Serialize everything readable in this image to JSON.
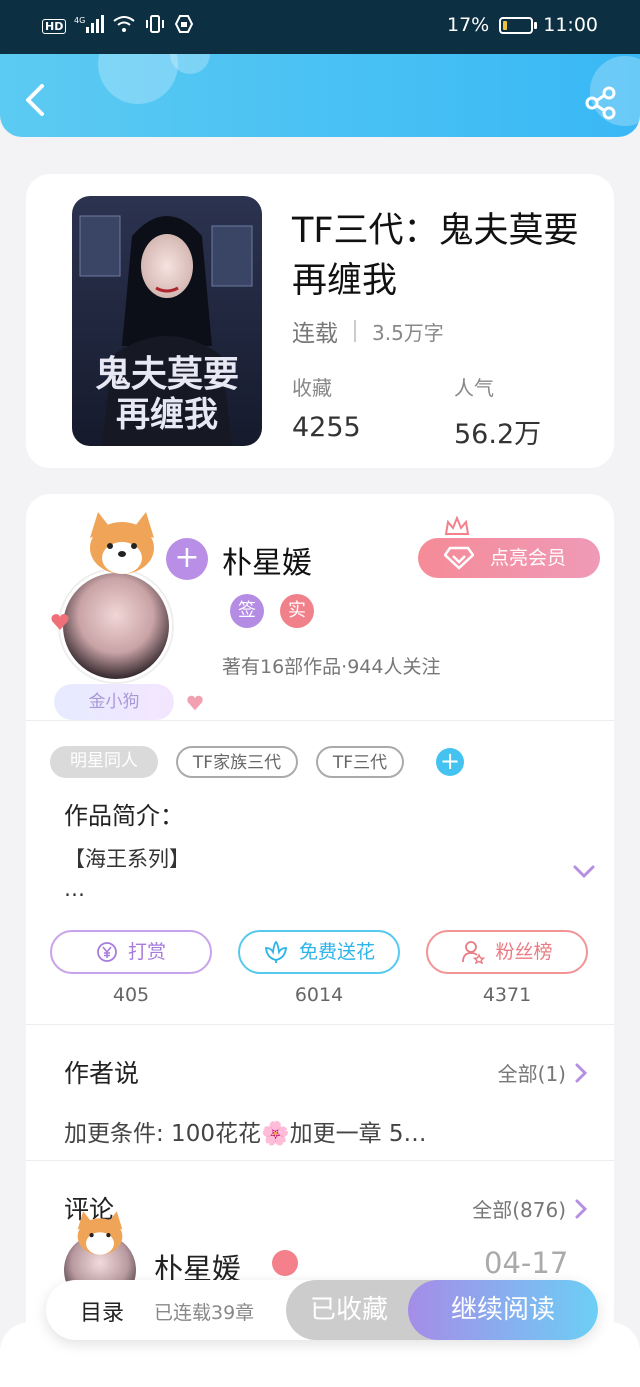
{
  "status_bar": {
    "network_icons": [
      "hd-icon",
      "signal-4g-icon",
      "wifi-icon",
      "vibrate-icon",
      "vpn-icon"
    ],
    "hd": "HD",
    "network": "4G",
    "battery": "17%",
    "battery_level": 0.17,
    "time": "11:00"
  },
  "header": {
    "back_icon": "chevron-left-icon",
    "share_icon": "share-icon"
  },
  "book": {
    "title": "TF三代：鬼夫莫要再缠我",
    "status": "连载",
    "word_count": "3.5万字",
    "favorites_label": "收藏",
    "favorites_value": "4255",
    "popularity_label": "人气",
    "popularity_value": "56.2万",
    "cover_text_line1": "鬼夫莫要",
    "cover_text_line2": "再缠我"
  },
  "author": {
    "name": "朴星媛",
    "fan_badge": "金小狗",
    "vip_button": "点亮会员",
    "badges": [
      {
        "label": "签",
        "color": "#b48ce3"
      },
      {
        "label": "实",
        "color": "#f0808a"
      }
    ],
    "meta": "著有16部作品·944人关注",
    "follow_symbol": "+"
  },
  "tags": [
    {
      "label": "明星同人",
      "style": "filled"
    },
    {
      "label": "TF家族三代",
      "style": "outline"
    },
    {
      "label": "TF三代",
      "style": "outline"
    }
  ],
  "tag_add_symbol": "+",
  "intro": {
    "title": "作品简介：",
    "text": "【海王系列】",
    "ellipsis": "…"
  },
  "actions": [
    {
      "label": "打赏",
      "count": "405",
      "icon": "yen-coin-icon"
    },
    {
      "label": "免费送花",
      "count": "6014",
      "icon": "flower-icon"
    },
    {
      "label": "粉丝榜",
      "count": "4371",
      "icon": "fan-ranking-icon"
    }
  ],
  "author_says": {
    "title": "作者说",
    "all": "全部(1)",
    "text": "加更条件: 100花花🌸加更一章 5…"
  },
  "comments": {
    "title": "评论",
    "all": "全部(876)",
    "first": {
      "name": "朴星媛",
      "date": "04-17"
    }
  },
  "bottom": {
    "toc": "目录",
    "toc_sub": "已连载39章",
    "favorited": "已收藏",
    "continue": "继续阅读"
  },
  "colors": {
    "header_gradient_start": "#5ccbf2",
    "header_gradient_end": "#39b8f5",
    "vip_pink": "#f58b97",
    "purple": "#b98ee6",
    "blue": "#45c3f0"
  }
}
